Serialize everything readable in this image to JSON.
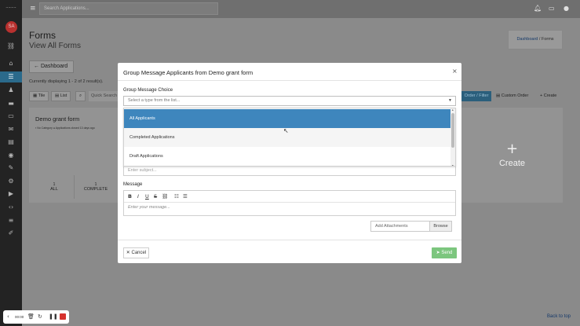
{
  "sidebar": {
    "logo": "~~~~",
    "avatar_initials": "SA",
    "items": [
      {
        "icon": "link-icon",
        "glyph": "⛓"
      },
      {
        "icon": "home-icon",
        "glyph": "⌂"
      },
      {
        "icon": "list-icon",
        "glyph": "☰"
      },
      {
        "icon": "users-icon",
        "glyph": "♟"
      },
      {
        "icon": "folder-icon",
        "glyph": "▬"
      },
      {
        "icon": "inbox-icon",
        "glyph": "▭"
      },
      {
        "icon": "mail-icon",
        "glyph": "✉"
      },
      {
        "icon": "calendar-icon",
        "glyph": "▦"
      },
      {
        "icon": "chart-icon",
        "glyph": "▤"
      },
      {
        "icon": "user-circle-icon",
        "glyph": "◉"
      },
      {
        "icon": "wrench-icon",
        "glyph": "✎"
      },
      {
        "icon": "gear-icon",
        "glyph": "⚙"
      },
      {
        "icon": "video-icon",
        "glyph": "▶"
      },
      {
        "icon": "code-icon",
        "glyph": "‹›"
      },
      {
        "icon": "list-ul-icon",
        "glyph": "≡"
      },
      {
        "icon": "edit-icon",
        "glyph": "✐"
      }
    ]
  },
  "topbar": {
    "search_placeholder": "Search Applications...",
    "icons": [
      "bell-icon",
      "chat-icon",
      "user-icon"
    ]
  },
  "page": {
    "title": "Forms",
    "subtitle": "View All Forms",
    "breadcrumb": {
      "link": "Dashboard",
      "sep": "/",
      "current": "Forms"
    },
    "dashboard_button": "Dashboard",
    "showing": "Currently displaying 1 - 2 of 2 result(s).",
    "view_tile": "Tile",
    "view_list": "List",
    "quick_search": "Quick Search",
    "order_filter": "Order / Filter",
    "custom_order": "Custom Order",
    "create_button": "Create",
    "back_to_top": "Back to top"
  },
  "card": {
    "title": "Demo grant form",
    "category": "No Category",
    "applications": "Applications closed 13 days ago",
    "stat_all": "ALL",
    "stat_complete": "COMPLETE",
    "stat_all_n": "1",
    "stat_complete_n": "1"
  },
  "create_card": {
    "plus": "+",
    "label": "Create"
  },
  "modal": {
    "title": "Group Message Applicants from Demo grant form",
    "close": "×",
    "choice_label": "Group Message Choice",
    "select_placeholder": "Select a type from the list...",
    "options": [
      {
        "label": "All Applicants",
        "selected": true
      },
      {
        "label": "Completed Applications",
        "selected": false
      },
      {
        "label": "Draft Applications",
        "selected": false
      }
    ],
    "subject_placeholder": "Enter subject...",
    "message_label": "Message",
    "message_placeholder": "Enter your message...",
    "toolbar": [
      "B",
      "I",
      "U",
      "S",
      "link",
      "ol",
      "ul"
    ],
    "attachments_placeholder": "Add Attachments",
    "browse": "Browse",
    "cancel": "Cancel",
    "send": "Send",
    "accent_color": "#3e86bd",
    "send_color": "#7cc67e"
  },
  "recorder": {
    "time": "00:00"
  }
}
